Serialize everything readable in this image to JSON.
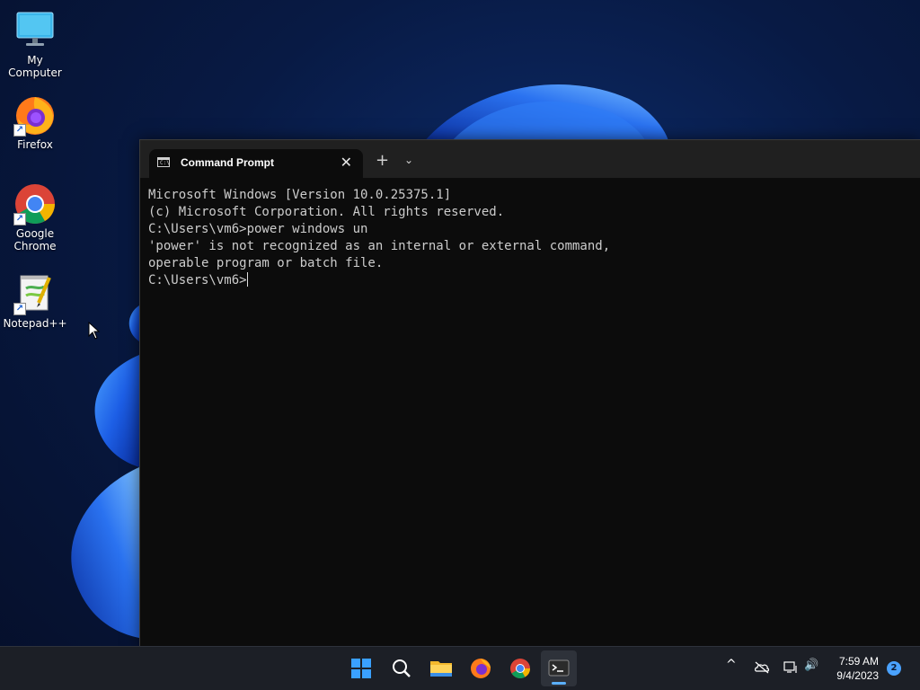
{
  "desktop": {
    "icons": [
      {
        "label": "My Computer"
      },
      {
        "label": "Firefox"
      },
      {
        "label": "Google Chrome"
      },
      {
        "label": "Notepad++"
      }
    ]
  },
  "terminal": {
    "tab_title": "Command Prompt",
    "tab_icon_text": "C:\\",
    "close_glyph": "✕",
    "new_tab_glyph": "+",
    "dropdown_glyph": "⌄",
    "lines": [
      "Microsoft Windows [Version 10.0.25375.1]",
      "(c) Microsoft Corporation. All rights reserved.",
      "",
      "C:\\Users\\vm6>power windows un",
      "'power' is not recognized as an internal or external command,",
      "operable program or batch file.",
      ""
    ],
    "prompt": "C:\\Users\\vm6>"
  },
  "taskbar": {
    "apps": [
      "start-button",
      "search-button",
      "file-explorer-button",
      "firefox-button",
      "chrome-button",
      "terminal-button"
    ],
    "clock_time": "7:59 AM",
    "clock_date": "9/4/2023",
    "notification_count": "2",
    "tray": {
      "overflow_glyph": "^",
      "volume_glyph": "🔊"
    }
  },
  "colors": {
    "accent": "#5bb0ff",
    "console_bg": "#0c0c0c",
    "console_fg": "#cccccc",
    "taskbar_bg": "#1c1f26"
  }
}
